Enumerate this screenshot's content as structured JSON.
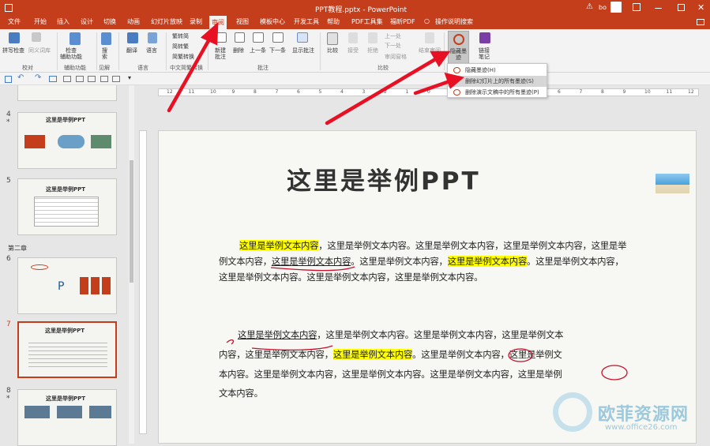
{
  "titlebar": {
    "title": "PPT教程.pptx  -  PowerPoint",
    "user": "bo"
  },
  "tabs": [
    "文件",
    "开始",
    "插入",
    "设计",
    "切换",
    "动画",
    "幻灯片放映",
    "录制",
    "审阅",
    "视图",
    "模板中心",
    "开发工具",
    "帮助",
    "PDF工具集",
    "福昕PDF",
    "操作说明搜索"
  ],
  "ribbon": {
    "spell": "拼写检查",
    "thesaurus": "同义词库",
    "check_access": "检查\n辅助功能",
    "search": "搜索",
    "translate": "翻译",
    "lang": "语言",
    "trad_to_simp": "繁转简",
    "simp_to_trad": "简转繁",
    "simp_trad": "简繁转换",
    "new_comment": "新建\n批注",
    "delete": "删除",
    "prev": "上一条",
    "next": "下一条",
    "show_comment": "显示批注",
    "compare": "比较",
    "accept": "接受",
    "reject": "拒绝",
    "prev_small": "上一处",
    "next_small": "下一处",
    "review_pane": "审阅窗格",
    "end_review": "结束审阅",
    "hide_ink": "隐藏墨\n迹",
    "link_notes": "链接\n笔记",
    "groups": {
      "proofing": "校对",
      "accessibility": "辅助功能",
      "insights": "见解",
      "language": "语言",
      "chinese": "中文简繁转换",
      "comments": "批注",
      "compare": "比较"
    }
  },
  "menu": {
    "items": [
      "隐藏墨迹(H)",
      "删除幻灯片上的所有墨迹(S)",
      "删除演示文稿中的所有墨迹(P)"
    ]
  },
  "sidebar": {
    "section2": "第二章",
    "slides": [
      {
        "num": "4",
        "title": "这里是举例PPT"
      },
      {
        "num": "5",
        "title": "这里是举例PPT"
      },
      {
        "num": "6",
        "title": ""
      },
      {
        "num": "7",
        "title": "这里是举例PPT"
      },
      {
        "num": "8",
        "title": "这里是举例PPT"
      }
    ]
  },
  "slide": {
    "title": "这里是举例PPT",
    "p1": {
      "l1a": "这里是举例文本内容",
      "l1b": "，这里是举例文本内容。这里是举例文本内容，这里是举例文本内容，这里是举",
      "l2a": "例文本内容，",
      "l2b": "这里是举例文本内容",
      "l2c": "。这里是举例文本内容，",
      "l2d": "这里是举例文本内容",
      "l2e": "。这里是举例文本内容，",
      "l3": "这里是举例文本内容。这里是举例文本内容，这里是举例文本内容。"
    },
    "p2": {
      "l1a": "这里是举例文本内容",
      "l1b": "，这里是举例文本内容。这里是举例文本内容，这里是举例文本",
      "l2a": "内容，这里是举例文本内容，",
      "l2b": "这里是举例文本内容",
      "l2c": "。这里是举例文本内容，这里是举例文",
      "l3": "本内容。这里是举例文本内容，这里是举例文本内容。这里是举例文本内容，这里是举例",
      "l4": "文本内容。"
    }
  },
  "ruler": [
    "12",
    "11",
    "10",
    "9",
    "8",
    "7",
    "6",
    "5",
    "4",
    "3",
    "2",
    "1",
    "0",
    "1",
    "2",
    "3",
    "4",
    "5",
    "6",
    "7",
    "8",
    "9",
    "10",
    "11",
    "12"
  ],
  "watermark": {
    "name": "欧菲资源网",
    "url": "www.office26.com"
  }
}
